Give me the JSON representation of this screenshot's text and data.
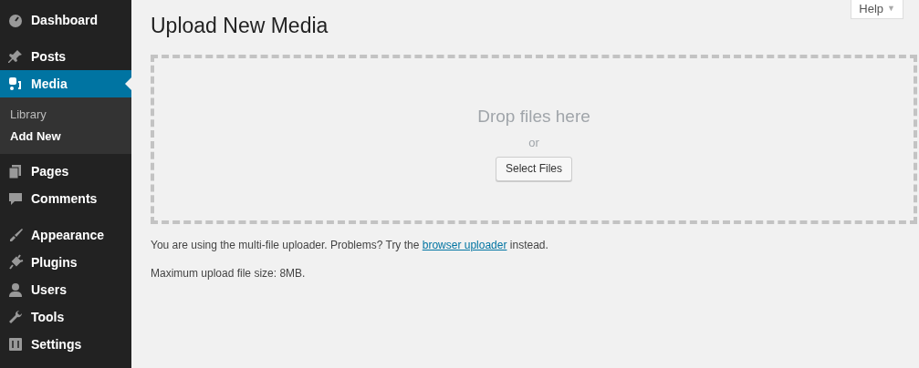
{
  "sidebar": {
    "groups": [
      [
        {
          "label": "Dashboard",
          "selected": false
        }
      ],
      [
        {
          "label": "Posts",
          "selected": false
        },
        {
          "label": "Media",
          "selected": true,
          "children": [
            {
              "label": "Library",
              "selected": false
            },
            {
              "label": "Add New",
              "selected": true
            }
          ]
        },
        {
          "label": "Pages",
          "selected": false
        },
        {
          "label": "Comments",
          "selected": false
        }
      ],
      [
        {
          "label": "Appearance",
          "selected": false
        },
        {
          "label": "Plugins",
          "selected": false
        },
        {
          "label": "Users",
          "selected": false
        },
        {
          "label": "Tools",
          "selected": false
        },
        {
          "label": "Settings",
          "selected": false
        }
      ]
    ]
  },
  "help_button": {
    "label": "Help",
    "caret": "▼"
  },
  "page_title": "Upload New Media",
  "drop_zone": {
    "heading": "Drop files here",
    "separator": "or",
    "button": "Select Files"
  },
  "uploader_note": {
    "before": "You are using the multi-file uploader. Problems? Try the ",
    "link": "browser uploader",
    "after": " instead."
  },
  "max_size": "Maximum upload file size: 8MB."
}
